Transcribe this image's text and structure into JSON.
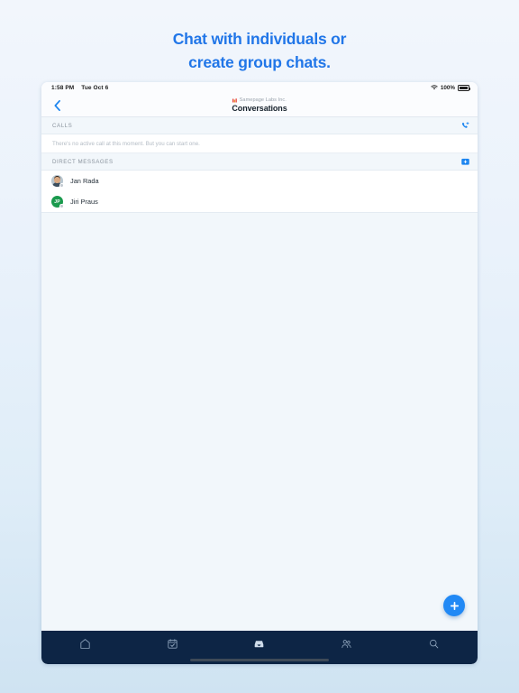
{
  "promo": {
    "line1": "Chat with individuals or",
    "line2": "create group chats."
  },
  "colors": {
    "accent_blue": "#2176e8",
    "action_blue": "#2189f5",
    "tabbar_navy": "#0d2545",
    "avatar_green": "#1a9a4d",
    "page_bg_top": "#f2f6fc",
    "page_bg_bottom": "#cfe3f2",
    "content_bg": "#f2f7fb"
  },
  "statusbar": {
    "time": "1:58 PM",
    "date": "Tue Oct 6",
    "battery_percent": "100%",
    "wifi_icon": "wifi-icon",
    "battery_icon": "battery-full-icon"
  },
  "navbar": {
    "back_icon": "chevron-left-icon",
    "org_logo_icon": "samepage-logo-icon",
    "org_name": "Samepage Labs Inc.",
    "title": "Conversations"
  },
  "sections": [
    {
      "id": "calls",
      "title": "CALLS",
      "action_icon": "phone-add-icon",
      "action_label": "Start a call",
      "empty_text": "There's no active call at this moment. But you can start one."
    },
    {
      "id": "direct-messages",
      "title": "DIRECT MESSAGES",
      "action_icon": "new-message-icon",
      "action_label": "New direct message"
    }
  ],
  "direct_messages": [
    {
      "name": "Jan Rada",
      "avatar_type": "photo",
      "initials": "",
      "status": "offline"
    },
    {
      "name": "Jiri Praus",
      "avatar_type": "initials",
      "initials": "JP",
      "status": "offline"
    }
  ],
  "fab": {
    "icon": "plus-icon",
    "label": "New conversation"
  },
  "tabbar": {
    "items": [
      {
        "id": "home",
        "icon": "home-icon",
        "label": "Home",
        "active": false
      },
      {
        "id": "tasks",
        "icon": "calendar-check-icon",
        "label": "Tasks",
        "active": false
      },
      {
        "id": "inbox",
        "icon": "inbox-icon",
        "label": "Inbox",
        "active": true
      },
      {
        "id": "people",
        "icon": "people-icon",
        "label": "People",
        "active": false
      },
      {
        "id": "search",
        "icon": "search-icon",
        "label": "Search",
        "active": false
      }
    ],
    "home_indicator": "home-indicator"
  }
}
